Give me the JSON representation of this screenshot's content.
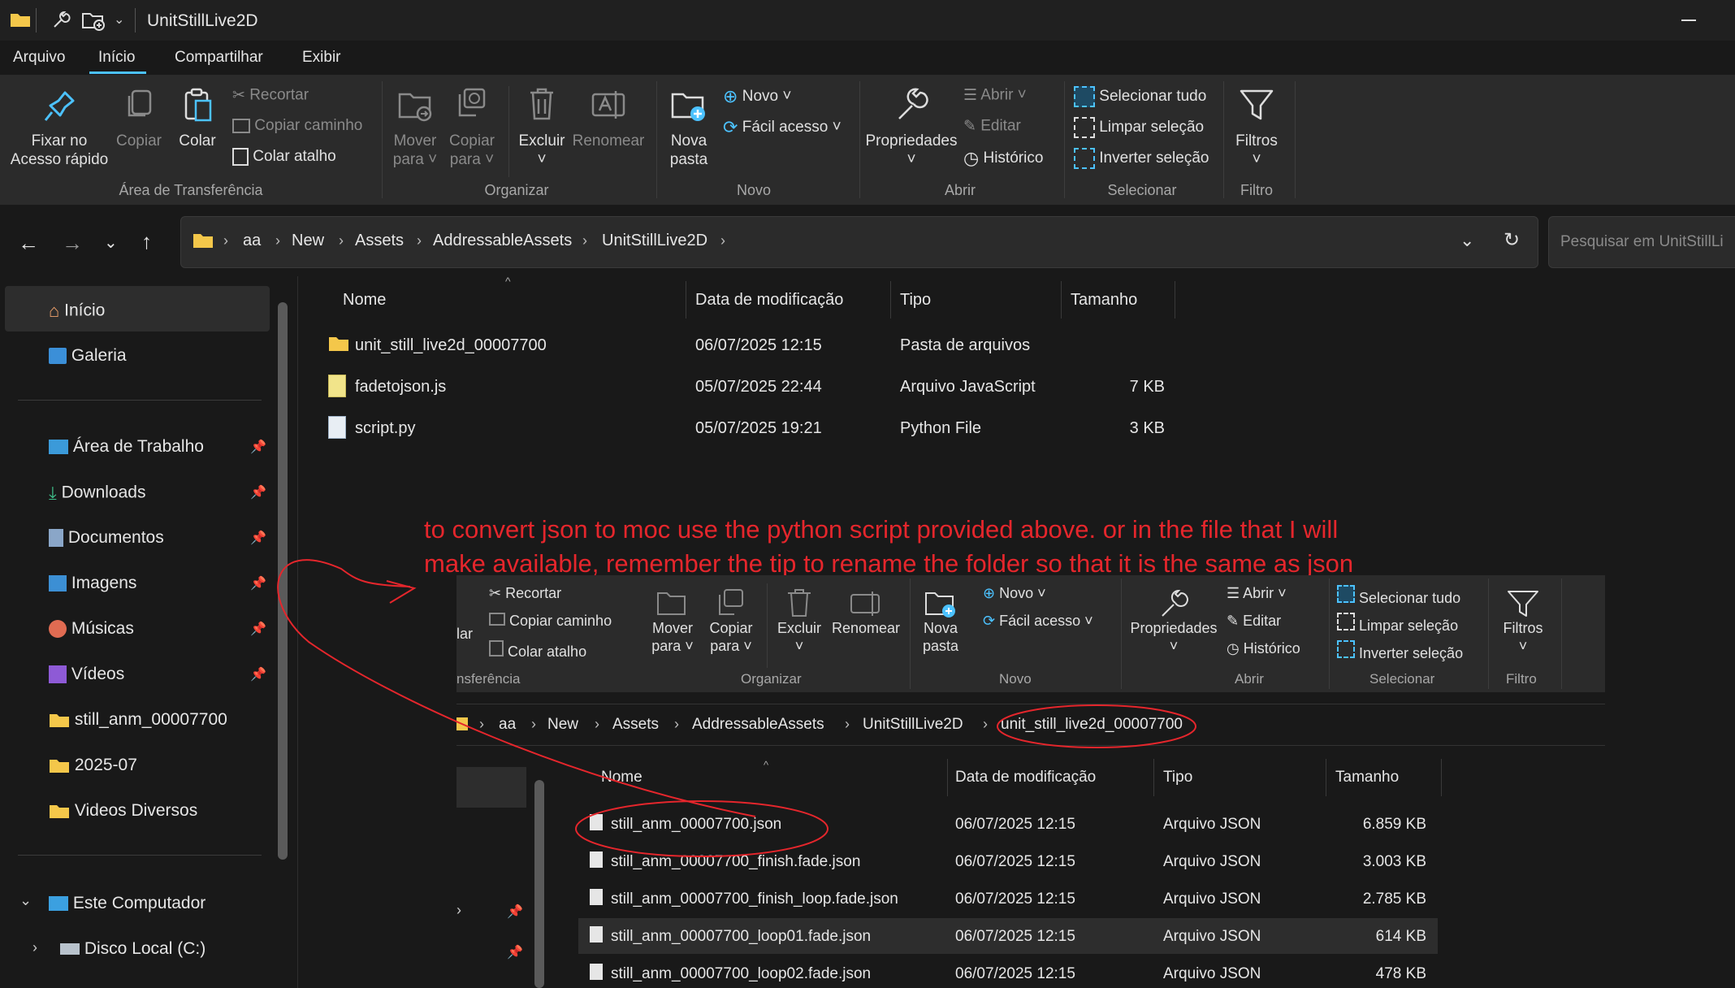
{
  "window": {
    "title": "UnitStillLive2D",
    "colors": {
      "bg": "#191919",
      "ribbon": "#2b2b2b",
      "accent": "#4cc2ff",
      "folder": "#f4c74a",
      "annotation": "#e5262c"
    }
  },
  "menu": {
    "tabs": [
      "Arquivo",
      "Início",
      "Compartilhar",
      "Exibir"
    ],
    "active": "Início"
  },
  "ribbon": {
    "pin_label_1": "Fixar no",
    "pin_label_2": "Acesso rápido",
    "copy": "Copiar",
    "paste": "Colar",
    "cut": "Recortar",
    "copy_path": "Copiar caminho",
    "paste_shortcut": "Colar atalho",
    "group_clipboard": "Área de Transferência",
    "move_1": "Mover",
    "move_2": "para",
    "copyto_1": "Copiar",
    "copyto_2": "para",
    "delete": "Excluir",
    "rename": "Renomear",
    "group_organize": "Organizar",
    "new_folder_1": "Nova",
    "new_folder_2": "pasta",
    "new": "Novo",
    "easy_access": "Fácil acesso",
    "group_new": "Novo",
    "properties": "Propriedades",
    "open": "Abrir",
    "edit": "Editar",
    "history": "Histórico",
    "group_open": "Abrir",
    "select_all": "Selecionar tudo",
    "select_none": "Limpar seleção",
    "invert": "Inverter seleção",
    "group_select": "Selecionar",
    "filters": "Filtros",
    "group_filter": "Filtro"
  },
  "address": {
    "crumbs": [
      "aa",
      "New",
      "Assets",
      "AddressableAssets",
      "UnitStillLive2D"
    ],
    "search_placeholder": "Pesquisar em UnitStillLi"
  },
  "sidebar": {
    "home": "Início",
    "gallery": "Galeria",
    "pinned": [
      "Área de Trabalho",
      "Downloads",
      "Documentos",
      "Imagens",
      "Músicas",
      "Vídeos"
    ],
    "folders": [
      "still_anm_00007700",
      "2025-07",
      "Videos Diversos"
    ],
    "this_pc": "Este Computador",
    "local_disk": "Disco Local (C:)"
  },
  "list": {
    "columns": [
      "Nome",
      "Data de modificação",
      "Tipo",
      "Tamanho"
    ],
    "rows": [
      {
        "name": "unit_still_live2d_00007700",
        "date": "06/07/2025 12:15",
        "type": "Pasta de arquivos",
        "size": ""
      },
      {
        "name": "fadetojson.js",
        "date": "05/07/2025 22:44",
        "type": "Arquivo JavaScript",
        "size": "7 KB"
      },
      {
        "name": "script.py",
        "date": "05/07/2025 19:21",
        "type": "Python File",
        "size": "3 KB"
      }
    ]
  },
  "annotation": {
    "line1": "to convert json to moc use the python script provided above. or in the file that I will",
    "line2": "make available, remember the tip to rename the folder so that it is the same as json"
  },
  "window2": {
    "ribbon": {
      "paste_partial": "lar",
      "cut": "Recortar",
      "copy_path": "Copiar caminho",
      "paste_shortcut": "Colar atalho",
      "group_clipboard_partial": "nsferência",
      "move_1": "Mover",
      "move_2": "para",
      "copyto_1": "Copiar",
      "copyto_2": "para",
      "delete": "Excluir",
      "rename": "Renomear",
      "group_organize": "Organizar",
      "new_folder_1": "Nova",
      "new_folder_2": "pasta",
      "new": "Novo",
      "easy_access": "Fácil acesso",
      "group_new": "Novo",
      "properties": "Propriedades",
      "open": "Abrir",
      "edit": "Editar",
      "history": "Histórico",
      "group_open": "Abrir",
      "select_all": "Selecionar tudo",
      "select_none": "Limpar seleção",
      "invert": "Inverter seleção",
      "group_select": "Selecionar",
      "filters": "Filtros",
      "group_filter": "Filtro"
    },
    "crumbs": [
      "aa",
      "New",
      "Assets",
      "AddressableAssets",
      "UnitStillLive2D",
      "unit_still_live2d_00007700"
    ],
    "columns": [
      "Nome",
      "Data de modificação",
      "Tipo",
      "Tamanho"
    ],
    "rows": [
      {
        "name": "still_anm_00007700.json",
        "date": "06/07/2025 12:15",
        "type": "Arquivo JSON",
        "size": "6.859 KB"
      },
      {
        "name": "still_anm_00007700_finish.fade.json",
        "date": "06/07/2025 12:15",
        "type": "Arquivo JSON",
        "size": "3.003 KB"
      },
      {
        "name": "still_anm_00007700_finish_loop.fade.json",
        "date": "06/07/2025 12:15",
        "type": "Arquivo JSON",
        "size": "2.785 KB"
      },
      {
        "name": "still_anm_00007700_loop01.fade.json",
        "date": "06/07/2025 12:15",
        "type": "Arquivo JSON",
        "size": "614 KB"
      },
      {
        "name": "still_anm_00007700_loop02.fade.json",
        "date": "06/07/2025 12:15",
        "type": "Arquivo JSON",
        "size": "478 KB"
      }
    ]
  }
}
